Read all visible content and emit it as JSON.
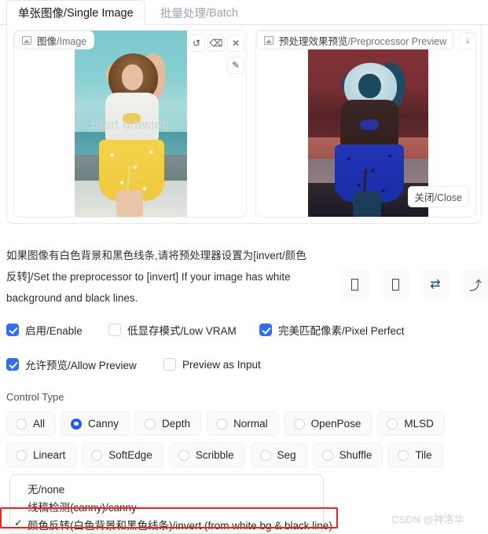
{
  "tabs": [
    {
      "cn": "单张图像",
      "en": "/Single Image",
      "active": true
    },
    {
      "cn": "批量处理",
      "en": "/Batch",
      "active": false
    }
  ],
  "image_panel": {
    "label_cn": "图像",
    "label_en": "/Image",
    "overlay_text": "Start drawing",
    "tools": {
      "undo": "↺",
      "eraser": "⌫",
      "close": "✕",
      "brush": "✎"
    }
  },
  "preview_panel": {
    "label_cn": "预处理效果预览",
    "label_en": "/Preprocessor Preview",
    "download": "⤓",
    "close_cn": "关闭",
    "close_en": "/Close"
  },
  "info": {
    "line1": "如果图像有白色背景和黑色线条,请将预处理器设置为[invert/颜色",
    "line2": "反转]/Set the preprocessor to [invert] If your image has white",
    "line3": "background and black lines."
  },
  "action_buttons": [
    {
      "name": "tofu-box-1",
      "glyph": ""
    },
    {
      "name": "tofu-box-2",
      "glyph": ""
    },
    {
      "name": "swap-icon",
      "glyph": "⇄"
    },
    {
      "name": "upload-arrow-icon",
      "glyph": "⤴"
    }
  ],
  "checkboxes": {
    "row1": [
      {
        "cn": "启用",
        "en": "/Enable",
        "checked": true
      },
      {
        "cn": "低显存模式",
        "en": "/Low VRAM",
        "checked": false
      },
      {
        "cn": "完美匹配像素",
        "en": "/Pixel Perfect",
        "checked": true
      }
    ],
    "row2": [
      {
        "cn": "允许预览",
        "en": "/Allow Preview",
        "checked": true
      },
      {
        "cn": "",
        "en": "Preview as Input",
        "checked": false
      }
    ]
  },
  "control_type": {
    "label": "Control Type",
    "row1": [
      {
        "label": "All",
        "selected": false
      },
      {
        "label": "Canny",
        "selected": true
      },
      {
        "label": "Depth",
        "selected": false
      },
      {
        "label": "Normal",
        "selected": false
      },
      {
        "label": "OpenPose",
        "selected": false
      },
      {
        "label": "MLSD",
        "selected": false
      }
    ],
    "row2": [
      {
        "label": "Lineart",
        "selected": false
      },
      {
        "label": "SoftEdge",
        "selected": false
      },
      {
        "label": "Scribble",
        "selected": false
      },
      {
        "label": "Seg",
        "selected": false
      },
      {
        "label": "Shuffle",
        "selected": false
      },
      {
        "label": "Tile",
        "selected": false
      }
    ]
  },
  "preprocessor_dropdown": {
    "options": [
      {
        "label": "无/none",
        "selected": false
      },
      {
        "label": "线稿检测(canny)/canny",
        "selected": false
      },
      {
        "label": "颜色反转(白色背景和黑色线条)/invert (from white bg & black line)",
        "selected": true
      }
    ],
    "highlight_color": "#ef2020"
  },
  "watermark": "CSDN @神洛华",
  "colors": {
    "accent_blue": "#2f6fed",
    "radio_blue": "#1e5cf0",
    "red_highlight": "#ef2020"
  }
}
